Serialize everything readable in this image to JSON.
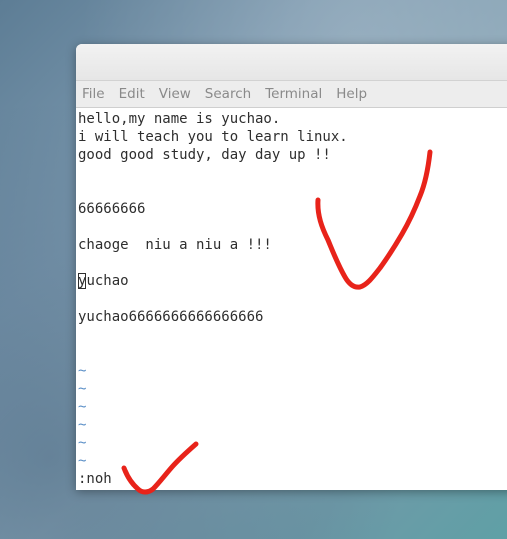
{
  "menu": {
    "items": [
      {
        "label": "File"
      },
      {
        "label": "Edit"
      },
      {
        "label": "View"
      },
      {
        "label": "Search"
      },
      {
        "label": "Terminal"
      },
      {
        "label": "Help"
      }
    ]
  },
  "terminal": {
    "lines": [
      "hello,my name is yuchao.",
      "i will teach you to learn linux.",
      "good good study, day day up !!",
      "",
      "",
      "66666666",
      "",
      "chaoge  niu a niu a !!!",
      "",
      "",
      "",
      "yuchao6666666666666666"
    ],
    "cursor_line": {
      "cursor_char": "y",
      "rest": "uchao"
    },
    "empty_marker": "~",
    "command": ":noh"
  },
  "colors": {
    "annotation": "#e8231a",
    "tilde": "#5b8fc7"
  }
}
